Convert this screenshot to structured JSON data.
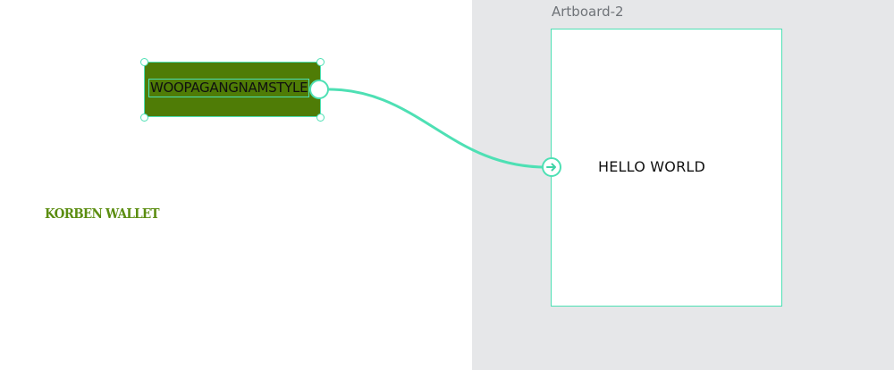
{
  "canvas": {
    "artboard": {
      "title": "Artboard-2",
      "text": "HELLO WORLD"
    },
    "selected_button": {
      "label": "WOOPAGANGNAMSTYLE",
      "fill_color": "#4f7c06",
      "selection_color": "#4ee0b4"
    },
    "prototype_link": {
      "start_icon": "connector-handle-icon",
      "end_icon": "arrow-right-circle-icon"
    },
    "logo": {
      "text": "KORBEN WALLET",
      "color": "#5b8d10"
    }
  }
}
